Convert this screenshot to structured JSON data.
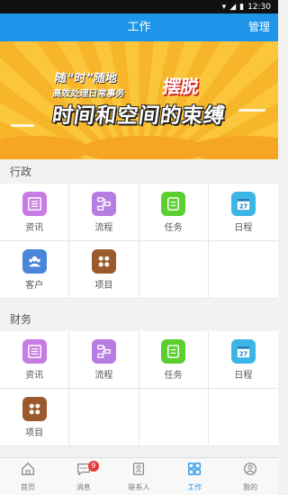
{
  "status": {
    "time": "12:30"
  },
  "header": {
    "title": "工作",
    "manage_label": "管理"
  },
  "banner": {
    "line1": "随“时”随地",
    "line1_small": "高效处理日常事务",
    "line1_big": "摆脱",
    "line2": "时间和空间的束缚"
  },
  "sections": [
    {
      "title": "行政",
      "items": [
        {
          "label": "资讯",
          "icon": "news-icon",
          "color": "#c77be3"
        },
        {
          "label": "流程",
          "icon": "flow-icon",
          "color": "#b67ce0"
        },
        {
          "label": "任务",
          "icon": "task-icon",
          "color": "#5ccf2e"
        },
        {
          "label": "日程",
          "icon": "calendar-icon",
          "color": "#3ab5e6",
          "day": "27"
        },
        {
          "label": "客户",
          "icon": "customer-icon",
          "color": "#4a86d8"
        },
        {
          "label": "项目",
          "icon": "project-icon",
          "color": "#9b5a2c"
        }
      ]
    },
    {
      "title": "财务",
      "items": [
        {
          "label": "资讯",
          "icon": "news-icon",
          "color": "#c77be3"
        },
        {
          "label": "流程",
          "icon": "flow-icon",
          "color": "#b67ce0"
        },
        {
          "label": "任务",
          "icon": "task-icon",
          "color": "#5ccf2e"
        },
        {
          "label": "日程",
          "icon": "calendar-icon",
          "color": "#3ab5e6",
          "day": "27"
        },
        {
          "label": "项目",
          "icon": "project-icon",
          "color": "#9b5a2c"
        }
      ]
    }
  ],
  "tabs": [
    {
      "label": "首页",
      "icon": "home-icon"
    },
    {
      "label": "消息",
      "icon": "message-icon",
      "badge": "9"
    },
    {
      "label": "联系人",
      "icon": "contacts-icon"
    },
    {
      "label": "工作",
      "icon": "work-icon",
      "active": true
    },
    {
      "label": "我的",
      "icon": "profile-icon"
    }
  ],
  "colors": {
    "accent": "#1e95e8",
    "banner": "#f9c033",
    "badge": "#e53935"
  }
}
